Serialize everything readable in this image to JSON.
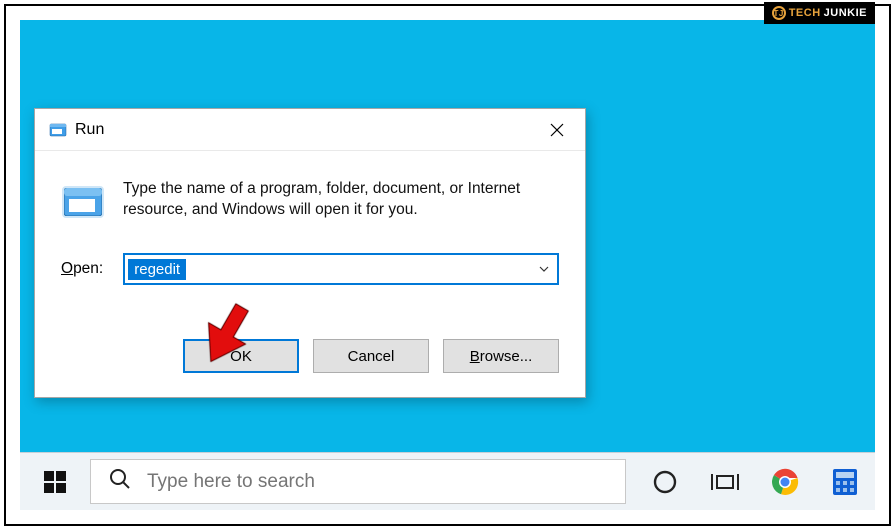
{
  "watermark": {
    "tech": "TECH",
    "junkie": "JUNKIE"
  },
  "dialog": {
    "title": "Run",
    "description": "Type the name of a program, folder, document, or Internet resource, and Windows will open it for you.",
    "open_label_prefix": "O",
    "open_label_rest": "pen:",
    "value": "regedit",
    "buttons": {
      "ok": "OK",
      "cancel": "Cancel",
      "browse_prefix": "B",
      "browse_rest": "rowse..."
    }
  },
  "taskbar": {
    "search_placeholder": "Type here to search"
  }
}
